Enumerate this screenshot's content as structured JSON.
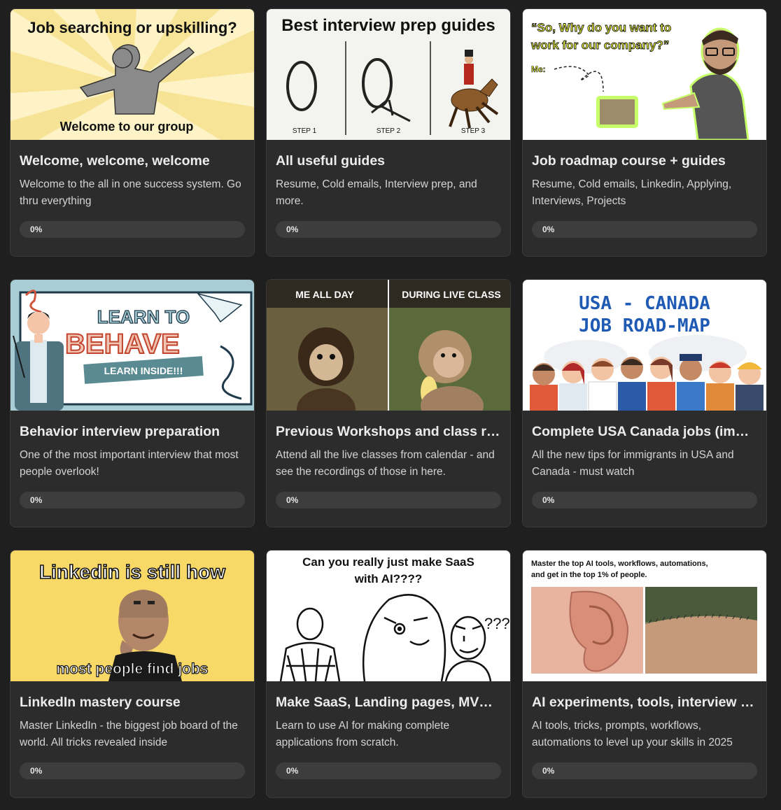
{
  "courses": [
    {
      "title": "Welcome, welcome, welcome",
      "description": "Welcome to the all in one success system. Go thru everything",
      "progress_label": "0%",
      "progress": 0,
      "thumb": {
        "top_text": "Job searching or upskilling?",
        "bottom_text": "Welcome to our group"
      }
    },
    {
      "title": "All useful guides",
      "description": "Resume, Cold emails, Interview prep, and more.",
      "progress_label": "0%",
      "progress": 0,
      "thumb": {
        "heading": "Best interview prep guides",
        "step1": "STEP 1",
        "step2": "STEP 2",
        "step3": "STEP 3"
      }
    },
    {
      "title": "Job roadmap course + guides",
      "description": "Resume, Cold emails, Linkedin, Applying, Interviews, Projects",
      "progress_label": "0%",
      "progress": 0,
      "thumb": {
        "line1": "“So, Why do you want to",
        "line2": "work for our company?”",
        "me": "Me:"
      }
    },
    {
      "title": "Behavior interview preparation",
      "description": "One of the most important interview that most people overlook!",
      "progress_label": "0%",
      "progress": 0,
      "thumb": {
        "line1": "LEARN TO",
        "line2": "BEHAVE",
        "line3": "LEARN INSIDE!!!"
      }
    },
    {
      "title": "Previous Workshops and class recordings",
      "description": "Attend all the live classes from calendar - and see the recordings of those in here.",
      "progress_label": "0%",
      "progress": 0,
      "thumb": {
        "left": "ME ALL DAY",
        "right": "DURING LIVE CLASS"
      }
    },
    {
      "title": "Complete USA Canada jobs (immigrants)",
      "description": "All the new tips for immigrants in USA and Canada - must watch",
      "progress_label": "0%",
      "progress": 0,
      "thumb": {
        "line1": "USA - CANADA",
        "line2": "JOB ROAD-MAP"
      }
    },
    {
      "title": "LinkedIn mastery course",
      "description": "Master LinkedIn - the biggest job board of the world. All tricks revealed inside",
      "progress_label": "0%",
      "progress": 0,
      "thumb": {
        "top": "Linkedin is still how",
        "bottom": "most people find jobs"
      }
    },
    {
      "title": "Make SaaS, Landing pages, MVPs with AI",
      "description": "Learn to use AI for making complete applications from scratch.",
      "progress_label": "0%",
      "progress": 0,
      "thumb": {
        "line1": "Can you really just make SaaS",
        "line2": "with AI????",
        "q": "???"
      }
    },
    {
      "title": "AI experiments, tools, interview prep",
      "description": "AI tools, tricks, prompts, workflows, automations to level up your skills in 2025",
      "progress_label": "0%",
      "progress": 0,
      "thumb": {
        "line1": "Master the top AI tools, workflows, automations,",
        "line2": "and get in the top 1% of people."
      }
    }
  ]
}
